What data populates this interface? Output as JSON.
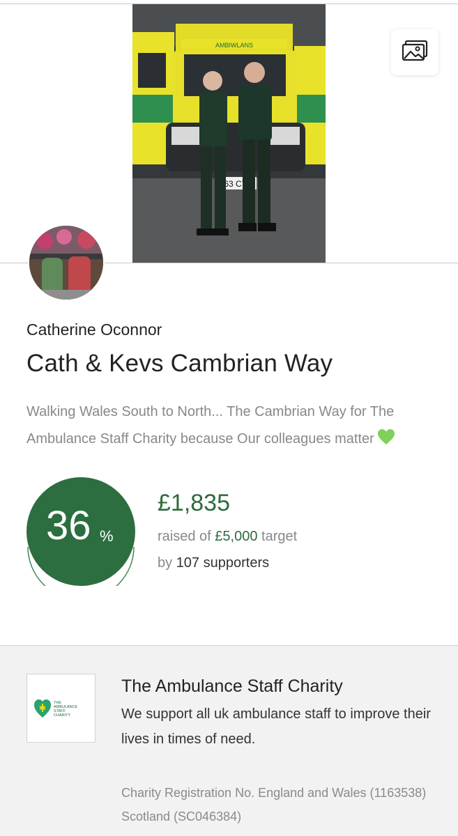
{
  "fundraiser": {
    "owner_name": "Catherine Oconnor",
    "title": "Cath & Kevs Cambrian Way",
    "description": "Walking Wales South to North... The Cambrian Way for The Ambulance Staff Charity because Our colleagues matter",
    "description_emoji": "green-heart"
  },
  "hero": {
    "vehicle_text": "AMBIWLANS",
    "plate_text": "63 CY"
  },
  "progress": {
    "percent": 36,
    "percent_label": "36",
    "percent_sign": "%",
    "raised_amount": "£1,835",
    "raised_prefix": "raised of",
    "target_amount": "£5,000",
    "target_suffix": "target",
    "supporters_prefix": "by",
    "supporters_count": "107 supporters"
  },
  "charity": {
    "name": "The Ambulance Staff Charity",
    "description": "We support all uk ambulance staff to improve their lives in times of need.",
    "registration": "Charity Registration No. England and Wales (1163538) Scotland (SC046384)",
    "logo_text": [
      "THE",
      "AMBULANCE",
      "STAFF",
      "CHARITY"
    ]
  },
  "colors": {
    "brand_green": "#2e6b3d",
    "progress_green": "#2c6e3f",
    "muted_text": "#888888",
    "charity_bg": "#f2f2f2"
  },
  "icons": {
    "gallery": "image-gallery-icon",
    "heart": "green-heart-icon"
  }
}
